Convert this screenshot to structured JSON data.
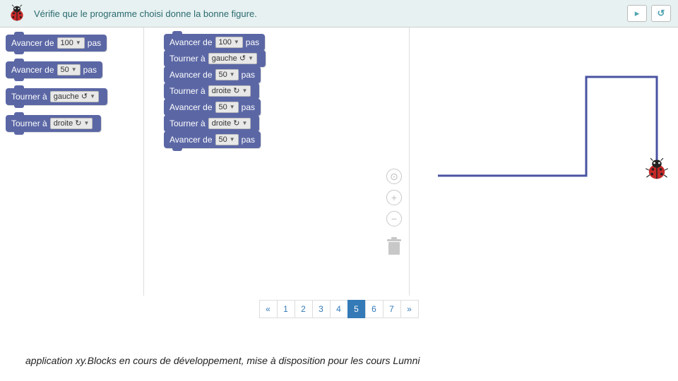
{
  "header": {
    "instruction": "Vérifie que le programme choisi donne la bonne figure."
  },
  "palette_blocks": [
    {
      "label1": "Avancer de",
      "dd": "100",
      "label2": "pas"
    },
    {
      "label1": "Avancer de",
      "dd": "50",
      "label2": "pas"
    },
    {
      "label1": "Tourner à",
      "dd": "gauche ↺",
      "label2": ""
    },
    {
      "label1": "Tourner à",
      "dd": "droite ↻",
      "label2": ""
    }
  ],
  "workspace_blocks": [
    {
      "label1": "Avancer de",
      "dd": "100",
      "label2": "pas"
    },
    {
      "label1": "Tourner à",
      "dd": "gauche ↺",
      "label2": ""
    },
    {
      "label1": "Avancer de",
      "dd": "50",
      "label2": "pas"
    },
    {
      "label1": "Tourner à",
      "dd": "droite ↻",
      "label2": ""
    },
    {
      "label1": "Avancer de",
      "dd": "50",
      "label2": "pas"
    },
    {
      "label1": "Tourner à",
      "dd": "droite ↻",
      "label2": ""
    },
    {
      "label1": "Avancer de",
      "dd": "50",
      "label2": "pas"
    }
  ],
  "pagination": {
    "prev": "«",
    "pages": [
      "1",
      "2",
      "3",
      "4",
      "5",
      "6",
      "7"
    ],
    "active": "5",
    "next": "»"
  },
  "footnote": "application xy.Blocks en cours de développement, mise à disposition pour les cours Lumni",
  "icons": {
    "play": "▸",
    "reset": "↺",
    "target": "⊙",
    "plus": "+",
    "minus": "−"
  }
}
